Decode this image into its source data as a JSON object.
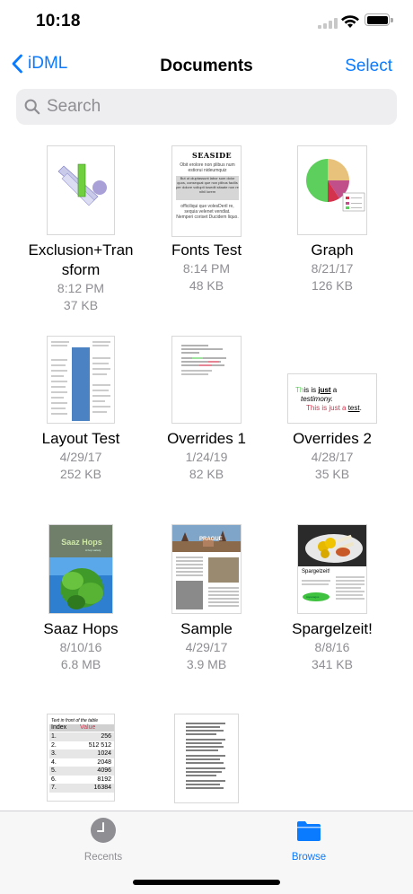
{
  "status": {
    "time": "10:18"
  },
  "nav": {
    "back_label": "iDML",
    "title": "Documents",
    "select_label": "Select"
  },
  "search": {
    "placeholder": "Search"
  },
  "files": [
    {
      "name": "Exclusion+Tran\nsform",
      "time": "8:12 PM",
      "size": "37 KB"
    },
    {
      "name": "Fonts Test",
      "time": "8:14 PM",
      "size": "48 KB",
      "thumb_text": {
        "title": "SEASIDE",
        "p1": "Obit erolore non plibus num estiorui nideumquiz",
        "p2": "But ut oluptassunt labor sum dolor quos, consequat que non plibus facilis per dolore vollupti tosedit sitaate non re nihil lorem",
        "p3": "officiliqui que volesDeril re, sequia velenet vendiat. Nemperi coriset Ducidem liquo."
      }
    },
    {
      "name": "Graph",
      "time": "8/21/17",
      "size": "126 KB"
    },
    {
      "name": "Layout Test",
      "time": "4/29/17",
      "size": "252 KB"
    },
    {
      "name": "Overrides 1",
      "time": "1/24/19",
      "size": "82 KB"
    },
    {
      "name": "Overrides 2",
      "time": "4/28/17",
      "size": "35 KB",
      "thumb_text": {
        "line1_a": "Th",
        "line1_b": "is is ",
        "line1_c": "just",
        "line1_d": " a",
        "line2": "testimony.",
        "line3_a": "This is just a ",
        "line3_b": "test",
        "line3_c": "."
      }
    },
    {
      "name": "Saaz Hops",
      "time": "8/10/16",
      "size": "6.8 MB",
      "thumb_text": {
        "title": "Saaz Hops",
        "sub": "A hop variety"
      }
    },
    {
      "name": "Sample",
      "time": "4/29/17",
      "size": "3.9 MB",
      "thumb_text": {
        "title": "PRAGUE"
      }
    },
    {
      "name": "Spargelzeit!",
      "time": "8/8/16",
      "size": "341 KB",
      "thumb_text": {
        "title": "Spargelzeit!",
        "badge": "Asparagus"
      }
    },
    {
      "name": "",
      "time": "",
      "size": "",
      "thumb_text": {
        "caption": "Text in front of the table",
        "h1": "Index",
        "h2": "Value",
        "rows": [
          [
            "1.",
            "256"
          ],
          [
            "2.",
            "512 512"
          ],
          [
            "3.",
            "1024"
          ],
          [
            "4.",
            "2048"
          ],
          [
            "5.",
            "4096"
          ],
          [
            "6.",
            "8192"
          ],
          [
            "7.",
            "16384"
          ]
        ]
      }
    },
    {
      "name": "",
      "time": "",
      "size": ""
    }
  ],
  "tabs": {
    "recents": "Recents",
    "browse": "Browse"
  },
  "colors": {
    "accent": "#0a7aff",
    "secondary_text": "#8e8e93"
  }
}
